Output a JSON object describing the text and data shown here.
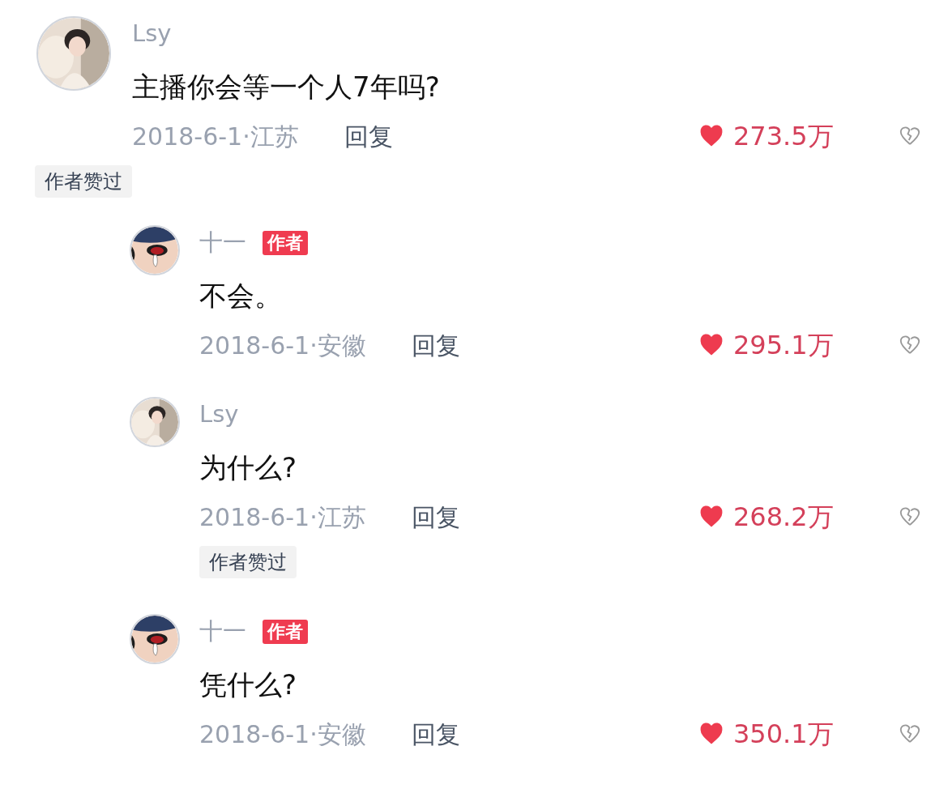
{
  "comments": [
    {
      "user": "Lsy",
      "text": "主播你会等一个人7年吗?",
      "date_location": "2018-6-1·江苏",
      "reply_label": "回复",
      "likes": "273.5万",
      "liked": true,
      "author_liked": "作者赞过",
      "replies": [
        {
          "user": "十一",
          "avatar": {
            "kind": "drawing"
          },
          "badge": "作者",
          "text": "不会。",
          "date_location": "2018-6-1·安徽",
          "reply_label": "回复",
          "likes": "295.1万",
          "liked": true
        },
        {
          "user": "Lsy",
          "text": "为什么?",
          "date_location": "2018-6-1·江苏",
          "reply_label": "回复",
          "likes": "268.2万",
          "liked": true,
          "author_liked": "作者赞过"
        },
        {
          "user": "十一",
          "avatar": {
            "kind": "drawing"
          },
          "badge": "作者",
          "text": "凭什么?",
          "date_location": "2018-6-1·安徽",
          "reply_label": "回复",
          "likes": "350.1万",
          "liked": true
        }
      ]
    }
  ]
}
